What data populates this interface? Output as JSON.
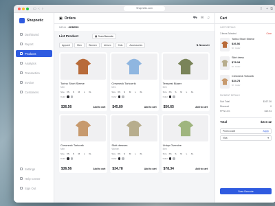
{
  "browser": {
    "url": "Shopnetic.com"
  },
  "brand": {
    "name": "Shopnetic",
    "accent": "#2f5be0"
  },
  "nav": [
    {
      "label": "Dashboard",
      "icon": "grid-icon"
    },
    {
      "label": "Report",
      "icon": "report-icon"
    },
    {
      "label": "Products",
      "icon": "box-icon",
      "active": true
    },
    {
      "label": "Analytics",
      "icon": "chart-icon"
    },
    {
      "label": "Transaction",
      "icon": "card-icon"
    },
    {
      "label": "Invoice",
      "icon": "invoice-icon"
    },
    {
      "label": "Customers",
      "icon": "users-icon"
    }
  ],
  "nav_bottom": [
    {
      "label": "Settings",
      "icon": "gear-icon"
    },
    {
      "label": "Help Center",
      "icon": "help-icon"
    },
    {
      "label": "Sign Out",
      "icon": "logout-icon"
    }
  ],
  "header": {
    "title": "Orders",
    "breadcrumb_root": "MENU",
    "breadcrumb_current": "ORDERS"
  },
  "list": {
    "title": "List Product",
    "scan_label": "Scan Barcode",
    "sort_label": "Newest"
  },
  "filters": [
    "Apparel",
    "Men",
    "Women",
    "Unisex",
    "Kids",
    "Accessories"
  ],
  "product_labels": {
    "size": "Size",
    "color": "Color",
    "add": "Add to cart"
  },
  "products": [
    {
      "name": "Torino Short Sleeve",
      "gender": "Men",
      "price": "$36.56",
      "sizes": [
        "XS",
        "S",
        "M",
        "L",
        "XL"
      ],
      "colors": [
        "#2c2c31",
        "#b6b8bc"
      ],
      "shape_color": "#b86b3a"
    },
    {
      "name": "Crewneck Tortcorrik",
      "gender": "Men",
      "price": "$45.89",
      "sizes": [
        "XS",
        "S",
        "M",
        "L",
        "XL"
      ],
      "colors": [
        "#2c2c31",
        "#b6b8bc"
      ],
      "shape_color": "#8fb6e0"
    },
    {
      "name": "Tempest Blazer",
      "gender": "Men",
      "price": "$50.65",
      "sizes": [
        "XS",
        "S",
        "M",
        "L",
        "XL"
      ],
      "colors": [
        "#2c2c31",
        "#b6b8bc"
      ],
      "shape_color": "#7a8459"
    },
    {
      "name": "Crewneck Tortcorik",
      "gender": "Men",
      "price": "$36.56",
      "sizes": [
        "XS",
        "S",
        "M",
        "L",
        "XL"
      ],
      "colors": [
        "#2c2c31",
        "#b6b8bc"
      ],
      "shape_color": "#c79a6e"
    },
    {
      "name": "Skirt dresses",
      "gender": "Women",
      "price": "$34.78",
      "sizes": [
        "XS",
        "S",
        "M",
        "L",
        "XL"
      ],
      "colors": [
        "#2c2c31",
        "#b6b8bc"
      ],
      "shape_color": "#b7ad8d"
    },
    {
      "name": "Uniqu Oversize",
      "gender": "Men",
      "price": "$78.34",
      "sizes": [
        "XS",
        "S",
        "M",
        "L",
        "XL"
      ],
      "colors": [
        "#2c2c31",
        "#b6b8bc"
      ],
      "shape_color": "#9fb57e"
    }
  ],
  "cart": {
    "title": "Cart",
    "section_label": "CART DETAILS",
    "selected_label": "3 Items Selected",
    "clear_label": "Clear",
    "items": [
      {
        "name": "Torino Short Sleeve",
        "price": "$36.56",
        "meta": "M  ·  Color",
        "shape_color": "#b86b3a"
      },
      {
        "name": "Skirt dress",
        "price": "$78.34",
        "meta": "M  ·  Color",
        "shape_color": "#b7ad8d"
      },
      {
        "name": "Crewneck Tortcorik",
        "price": "$34.78",
        "meta": "M  ·  Color",
        "shape_color": "#c79a6e"
      }
    ],
    "payment_label": "PAYMENT DETAILS",
    "summary": [
      {
        "label": "Sub Total",
        "value": "$167.36"
      },
      {
        "label": "Discount",
        "value": "0"
      },
      {
        "label": "PPN 11%",
        "value": "$19.94"
      }
    ],
    "total_label": "Total",
    "total_value": "$217.12",
    "promo_placeholder": "Promo code",
    "apply_label": "Apply",
    "payment_method": "Visa",
    "checkout_label": "Scan Barcode"
  }
}
